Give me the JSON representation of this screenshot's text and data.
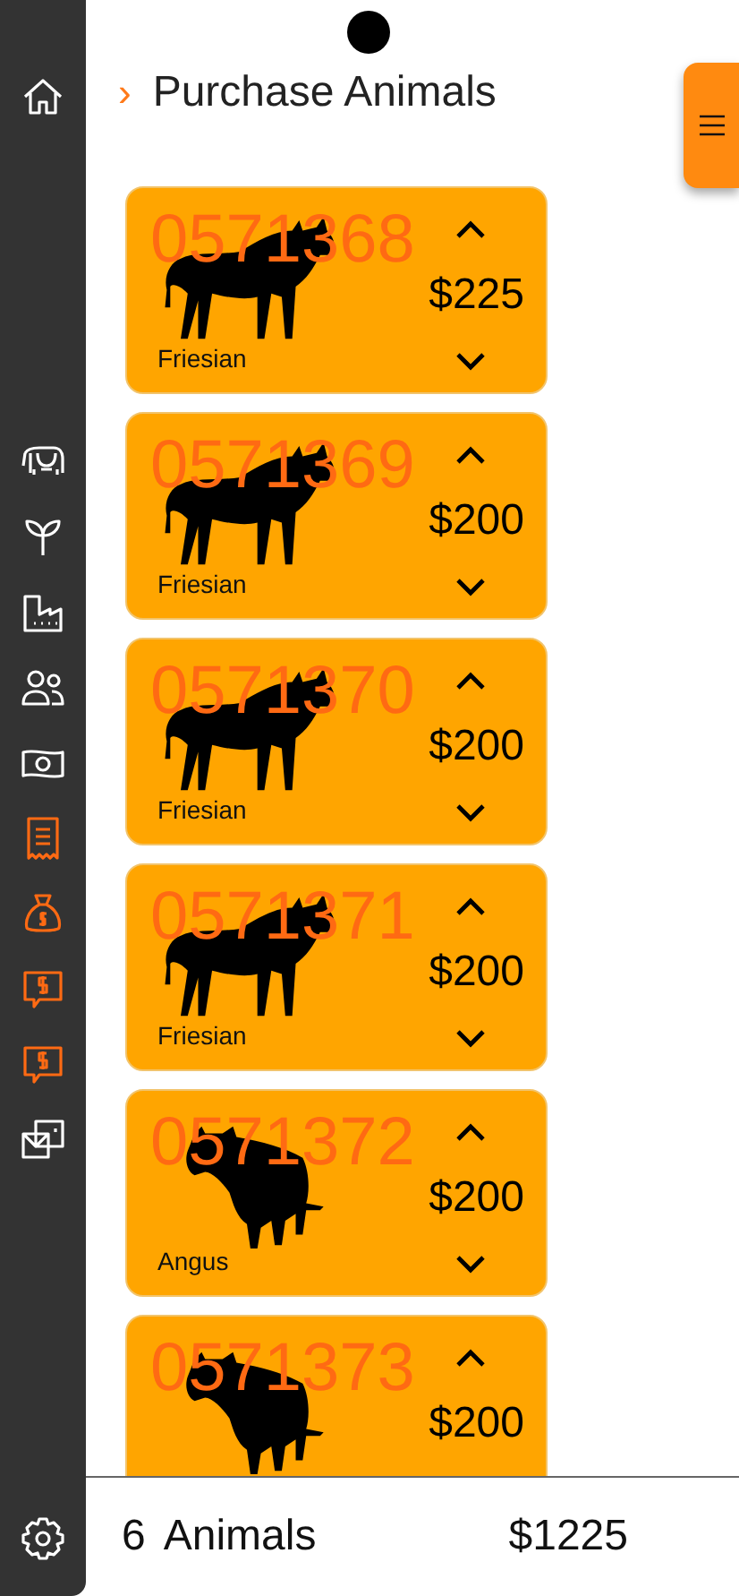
{
  "sidebar": {
    "items": [
      {
        "highlighted": false
      },
      {
        "highlighted": false
      },
      {
        "highlighted": false
      },
      {
        "highlighted": false
      },
      {
        "highlighted": false
      },
      {
        "highlighted": false
      },
      {
        "highlighted": true
      },
      {
        "highlighted": true
      },
      {
        "highlighted": true
      },
      {
        "highlighted": true
      },
      {
        "highlighted": false
      }
    ]
  },
  "header": {
    "chevron": "›",
    "title": "Purchase Animals"
  },
  "animals": [
    {
      "tag": "0571368",
      "kind": "bull",
      "breed": "Friesian",
      "price": "$225"
    },
    {
      "tag": "0571369",
      "kind": "bull",
      "breed": "Friesian",
      "price": "$200"
    },
    {
      "tag": "0571370",
      "kind": "bull",
      "breed": "Friesian",
      "price": "$200"
    },
    {
      "tag": "0571371",
      "kind": "bull",
      "breed": "Friesian",
      "price": "$200"
    },
    {
      "tag": "0571372",
      "kind": "cow",
      "breed": "Angus",
      "price": "$200"
    },
    {
      "tag": "0571373",
      "kind": "cow",
      "price": "$200"
    }
  ],
  "footer": {
    "count": "6",
    "label": "Animals",
    "total": "$1225"
  }
}
